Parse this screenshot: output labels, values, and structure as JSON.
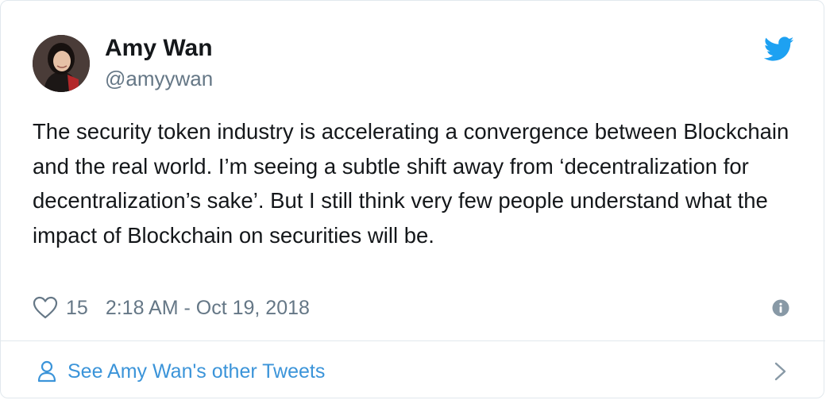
{
  "tweet": {
    "author_name": "Amy Wan",
    "author_handle": "@amyywan",
    "text": "The security token industry is accelerating a convergence between Blockchain and the real world. I’m seeing a subtle shift away from ‘decentralization for decentralization’s sake’. But I still think very few people understand what the impact of Blockchain on securities will be.",
    "like_count": "15",
    "timestamp": "2:18 AM - Oct 19, 2018"
  },
  "footer": {
    "link_text": "See Amy Wan's other Tweets"
  },
  "icons": {
    "brand": "twitter-bird-icon",
    "like": "heart-icon",
    "info": "info-icon",
    "profile": "person-icon",
    "more": "chevron-right-icon"
  },
  "colors": {
    "twitter_blue": "#1da1f2",
    "link_blue": "#3b94d9",
    "text_primary": "#14171a",
    "text_secondary": "#657786",
    "border": "#e1e8ed"
  }
}
